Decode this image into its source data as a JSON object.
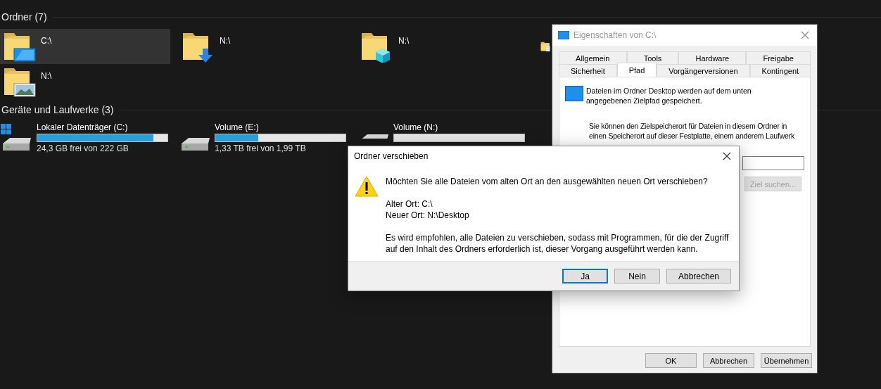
{
  "explorer": {
    "sections": [
      {
        "title": "Ordner (7)",
        "kind": "folders",
        "items": [
          {
            "label": "C:\\",
            "kind": "desktop",
            "selected": true
          },
          {
            "label": "N:\\",
            "kind": "downloads",
            "selected": false
          },
          {
            "label": "N:\\",
            "kind": "objects",
            "selected": false
          },
          {
            "kind": "documents",
            "selected": false
          },
          {
            "label": "N:\\",
            "kind": "pictures",
            "selected": false
          }
        ]
      },
      {
        "title": "Geräte und Laufwerke (3)",
        "kind": "drives",
        "items": [
          {
            "name": "Lokaler Datenträger (C:)",
            "level": 0.89,
            "free": "24,3 GB frei von 222 GB",
            "system": true
          },
          {
            "name": "Volume (E:)",
            "level": 0.33,
            "free": "1,33 TB frei von 1,99 TB",
            "system": false
          },
          {
            "name": "Volume (N:)",
            "level": 0,
            "system": false
          }
        ]
      }
    ]
  },
  "properties": {
    "title": "Eigenschaften von C:\\",
    "tab_rows": [
      [
        {
          "label": "Allgemein",
          "selected": false
        },
        {
          "label": "Tools",
          "selected": false
        },
        {
          "label": "Hardware",
          "selected": false
        },
        {
          "label": "Freigabe",
          "selected": false
        }
      ],
      [
        {
          "label": "Sicherheit",
          "selected": false
        },
        {
          "label": "Pfad",
          "selected": true
        },
        {
          "label": "Vorgängerversionen",
          "selected": false
        },
        {
          "label": "Kontingent",
          "selected": false
        }
      ]
    ],
    "intro": "Dateien im Ordner Desktop werden auf dem unten angegebenen Zielpfad gespeichert.",
    "description_lines": [
      "Sie können den Zielspeicherort für Dateien in diesem Ordner in",
      "einen Speicherort auf dieser Festplatte, einem anderem Laufwerk"
    ],
    "find_button": {
      "label": "Ziel suchen...",
      "disabled": true
    },
    "buttons": [
      "OK",
      "Abbrechen",
      "Übernehmen"
    ]
  },
  "dialog": {
    "title": "Ordner verschieben",
    "question": "Möchten Sie alle Dateien vom alten Ort an den ausgewählten neuen Ort verschieben?",
    "old_location": "Alter Ort: C:\\",
    "new_location": "Neuer Ort: N:\\Desktop",
    "note": "Es wird empfohlen, alle Dateien zu verschieben, sodass mit Programmen, für die der Zugriff auf den Inhalt des Ordners erforderlich ist, dieser Vorgang ausgeführt werden kann.",
    "buttons": [
      {
        "label": "Ja",
        "default": true
      },
      {
        "label": "Nein",
        "default": false
      },
      {
        "label": "Abbrechen",
        "default": false
      }
    ]
  }
}
